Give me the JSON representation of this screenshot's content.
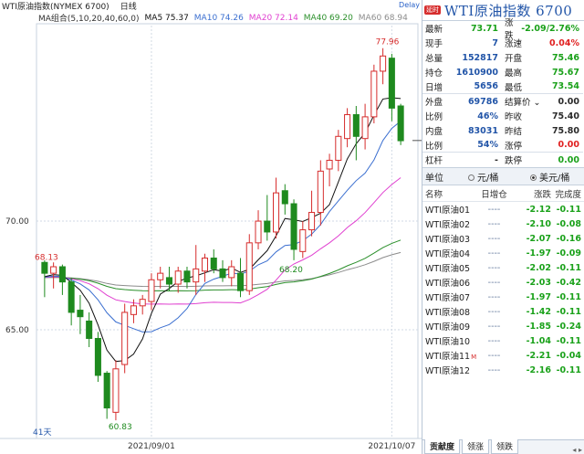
{
  "chart_header": {
    "symbol": "WTI原油指数(NYMEX 6700)",
    "period": "日线",
    "ma_group": "MA组合(5,10,20,40,60,0)",
    "ma5": "MA5 75.37",
    "ma10": "MA10 74.26",
    "ma20": "MA20 72.14",
    "ma40": "MA40 69.20",
    "ma60": "MA60 68.94",
    "delay": "Delay"
  },
  "colors": {
    "up": "#d62c2c",
    "down": "#1e8a1e",
    "ma5": "#111111",
    "ma10": "#3b6fd0",
    "ma20": "#e040d0",
    "ma40": "#2a8f2a",
    "ma60": "#8c8c8c",
    "accent": "#2255a8"
  },
  "chart_data": {
    "type": "candlestick",
    "y_ticks": [
      "70.00",
      "65.00"
    ],
    "x_ticks": [
      "2021/09/01",
      "2021/10/07"
    ],
    "annotations": {
      "high": "77.96",
      "low": "60.83",
      "left_mark": "68.13",
      "mid_mark": "68.20",
      "days": "41天"
    },
    "ylim": [
      60.5,
      79
    ],
    "candles": [
      {
        "o": 68.1,
        "h": 68.2,
        "l": 66.5,
        "c": 67.6
      },
      {
        "o": 67.6,
        "h": 68.1,
        "l": 66.9,
        "c": 67.9
      },
      {
        "o": 67.9,
        "h": 68.0,
        "l": 66.6,
        "c": 67.2
      },
      {
        "o": 67.2,
        "h": 67.4,
        "l": 65.2,
        "c": 65.8
      },
      {
        "o": 65.9,
        "h": 66.6,
        "l": 64.8,
        "c": 65.6
      },
      {
        "o": 65.4,
        "h": 65.8,
        "l": 64.2,
        "c": 64.6
      },
      {
        "o": 64.6,
        "h": 64.9,
        "l": 62.6,
        "c": 62.9
      },
      {
        "o": 63.0,
        "h": 63.1,
        "l": 60.9,
        "c": 61.4
      },
      {
        "o": 61.2,
        "h": 63.6,
        "l": 60.83,
        "c": 63.2
      },
      {
        "o": 63.4,
        "h": 66.2,
        "l": 63.0,
        "c": 65.8
      },
      {
        "o": 65.7,
        "h": 66.4,
        "l": 65.3,
        "c": 66.1
      },
      {
        "o": 66.1,
        "h": 66.6,
        "l": 65.7,
        "c": 66.4
      },
      {
        "o": 66.3,
        "h": 67.6,
        "l": 65.9,
        "c": 67.3
      },
      {
        "o": 67.3,
        "h": 67.9,
        "l": 66.9,
        "c": 67.6
      },
      {
        "o": 67.4,
        "h": 67.9,
        "l": 66.8,
        "c": 67.1
      },
      {
        "o": 67.1,
        "h": 67.9,
        "l": 66.7,
        "c": 67.7
      },
      {
        "o": 67.7,
        "h": 67.9,
        "l": 66.9,
        "c": 67.2
      },
      {
        "o": 67.2,
        "h": 68.9,
        "l": 66.6,
        "c": 67.8
      },
      {
        "o": 67.7,
        "h": 68.5,
        "l": 67.2,
        "c": 68.3
      },
      {
        "o": 68.3,
        "h": 68.7,
        "l": 67.6,
        "c": 67.8
      },
      {
        "o": 67.8,
        "h": 68.2,
        "l": 67.2,
        "c": 67.4
      },
      {
        "o": 67.4,
        "h": 68.2,
        "l": 67.0,
        "c": 67.9
      },
      {
        "o": 67.6,
        "h": 68.3,
        "l": 66.5,
        "c": 66.8
      },
      {
        "o": 66.8,
        "h": 69.4,
        "l": 66.6,
        "c": 69.0
      },
      {
        "o": 69.0,
        "h": 70.5,
        "l": 68.7,
        "c": 70.0
      },
      {
        "o": 70.0,
        "h": 71.2,
        "l": 69.1,
        "c": 69.5
      },
      {
        "o": 69.5,
        "h": 72.0,
        "l": 69.2,
        "c": 71.3
      },
      {
        "o": 71.4,
        "h": 71.7,
        "l": 70.3,
        "c": 70.8
      },
      {
        "o": 70.8,
        "h": 71.0,
        "l": 68.2,
        "c": 68.7
      },
      {
        "o": 68.6,
        "h": 70.0,
        "l": 68.3,
        "c": 69.6
      },
      {
        "o": 69.6,
        "h": 71.4,
        "l": 69.3,
        "c": 70.4
      },
      {
        "o": 70.4,
        "h": 72.8,
        "l": 69.8,
        "c": 72.3
      },
      {
        "o": 72.4,
        "h": 73.1,
        "l": 71.6,
        "c": 72.8
      },
      {
        "o": 72.8,
        "h": 74.2,
        "l": 72.3,
        "c": 73.9
      },
      {
        "o": 73.8,
        "h": 75.2,
        "l": 73.4,
        "c": 74.9
      },
      {
        "o": 74.9,
        "h": 75.3,
        "l": 72.8,
        "c": 73.9
      },
      {
        "o": 73.8,
        "h": 75.4,
        "l": 73.3,
        "c": 74.8
      },
      {
        "o": 74.8,
        "h": 77.2,
        "l": 74.5,
        "c": 76.9
      },
      {
        "o": 76.9,
        "h": 77.96,
        "l": 76.3,
        "c": 77.6
      },
      {
        "o": 77.5,
        "h": 77.7,
        "l": 74.6,
        "c": 75.2
      },
      {
        "o": 75.3,
        "h": 75.4,
        "l": 73.5,
        "c": 73.7
      }
    ]
  },
  "quote": {
    "title": "WTI原油指数  6700",
    "badge": "延时",
    "rows": [
      {
        "l1": "最新",
        "v1": "73.71",
        "c1": "green",
        "l2": "涨跌",
        "v2": "-2.09/2.76%",
        "c2": "green"
      },
      {
        "l1": "现手",
        "v1": "7",
        "c1": "blue",
        "l2": "涨速",
        "v2": "0.04%",
        "c2": "red"
      },
      {
        "l1": "总量",
        "v1": "152817",
        "c1": "blue",
        "l2": "开盘",
        "v2": "75.46",
        "c2": "green"
      },
      {
        "l1": "持仓",
        "v1": "1610900",
        "c1": "blue",
        "l2": "最高",
        "v2": "75.67",
        "c2": "green"
      },
      {
        "l1": "日增",
        "v1": "5656",
        "c1": "blue",
        "l2": "最低",
        "v2": "73.54",
        "c2": "green"
      },
      {
        "l1": "外盘",
        "v1": "69786",
        "c1": "blue",
        "l2": "结算价 ⌄",
        "v2": "0.00",
        "c2": ""
      },
      {
        "l1": "比例",
        "v1": "46%",
        "c1": "blue",
        "l2": "昨收",
        "v2": "75.40",
        "c2": ""
      },
      {
        "l1": "内盘",
        "v1": "83031",
        "c1": "blue",
        "l2": "昨结",
        "v2": "75.80",
        "c2": ""
      },
      {
        "l1": "比例",
        "v1": "54%",
        "c1": "blue",
        "l2": "涨停",
        "v2": "0.00",
        "c2": "red"
      },
      {
        "l1": "杠杆",
        "v1": "-",
        "c1": "",
        "l2": "跌停",
        "v2": "0.00",
        "c2": "green"
      }
    ],
    "unit_label": "单位",
    "unit_opt1": "元/桶",
    "unit_opt2": "美元/桶"
  },
  "list": {
    "headers": [
      "名称",
      "日增仓",
      "涨跌",
      "完成度"
    ],
    "rows": [
      {
        "name": "WTI原油01",
        "zeng": "----",
        "chg": "-2.12",
        "pct": "-0.11",
        "m": ""
      },
      {
        "name": "WTI原油02",
        "zeng": "----",
        "chg": "-2.10",
        "pct": "-0.08",
        "m": ""
      },
      {
        "name": "WTI原油03",
        "zeng": "----",
        "chg": "-2.07",
        "pct": "-0.16",
        "m": ""
      },
      {
        "name": "WTI原油04",
        "zeng": "----",
        "chg": "-1.97",
        "pct": "-0.09",
        "m": ""
      },
      {
        "name": "WTI原油05",
        "zeng": "----",
        "chg": "-2.02",
        "pct": "-0.11",
        "m": ""
      },
      {
        "name": "WTI原油06",
        "zeng": "----",
        "chg": "-2.03",
        "pct": "-0.42",
        "m": ""
      },
      {
        "name": "WTI原油07",
        "zeng": "----",
        "chg": "-1.97",
        "pct": "-0.11",
        "m": ""
      },
      {
        "name": "WTI原油08",
        "zeng": "----",
        "chg": "-1.42",
        "pct": "-0.11",
        "m": ""
      },
      {
        "name": "WTI原油09",
        "zeng": "----",
        "chg": "-1.85",
        "pct": "-0.24",
        "m": ""
      },
      {
        "name": "WTI原油10",
        "zeng": "----",
        "chg": "-1.04",
        "pct": "-0.11",
        "m": ""
      },
      {
        "name": "WTI原油11",
        "zeng": "----",
        "chg": "-2.21",
        "pct": "-0.04",
        "m": "M"
      },
      {
        "name": "WTI原油12",
        "zeng": "----",
        "chg": "-2.16",
        "pct": "-0.11",
        "m": ""
      }
    ]
  },
  "tabs": [
    "贡献度",
    "领涨",
    "领跌"
  ],
  "tab_arrows": "◂ ▸"
}
